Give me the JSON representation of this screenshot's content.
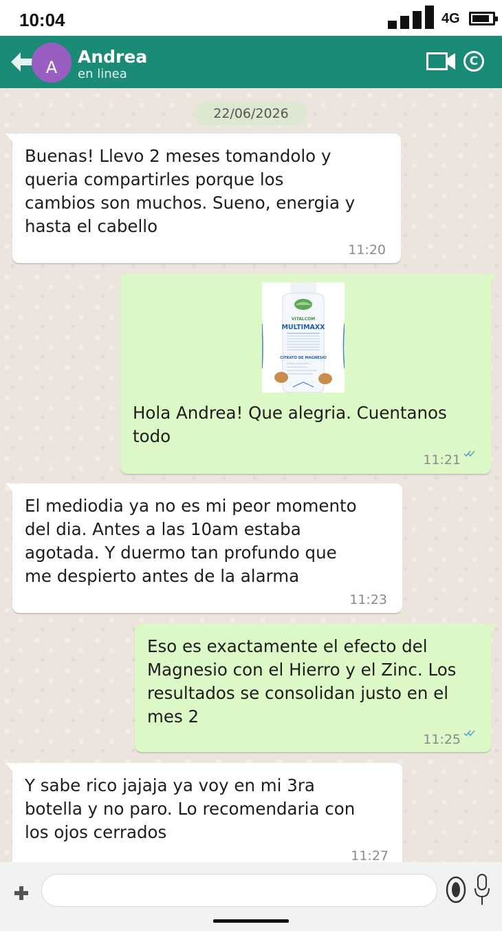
{
  "status_bar": {
    "time": "10:04",
    "network": "4G",
    "icons": [
      "signal-icon",
      "battery-icon"
    ]
  },
  "header": {
    "back_icon": "back-arrow-icon",
    "avatar_letter": "A",
    "name": "Andrea",
    "status": "en linea",
    "video_icon": "video-call-icon",
    "call_icon": "call-icon",
    "call_glyph": "C",
    "colors": {
      "header_bg": "#1a8b77",
      "avatar_bg": "#9a5dc1"
    }
  },
  "chat": {
    "date": "22/06/2026",
    "colors": {
      "incoming_bubble": "#ffffff",
      "outgoing_bubble": "#dcf8c6",
      "background": "#ece5dd",
      "read_ticks": "#4fa3d9"
    },
    "messages": [
      {
        "direction": "incoming",
        "lines": [
          "Buenas! Llevo 2 meses tomandolo y",
          "queria compartirles porque los",
          "cambios son muchos. Sueno, energia y",
          "hasta el cabello"
        ],
        "time": "11:20"
      },
      {
        "direction": "outgoing",
        "image": {
          "brand": "VITALCOM",
          "product": "MULTIMAXX",
          "subtitle": "CITRATO DE MAGNESIO"
        },
        "lines": [
          "Hola Andrea! Que alegria. Cuentanos",
          "todo"
        ],
        "time": "11:21",
        "read": true
      },
      {
        "direction": "incoming",
        "lines": [
          "El mediodia ya no es mi peor momento",
          "del dia. Antes a las 10am estaba",
          "agotada. Y duermo tan profundo que",
          "me despierto antes de la alarma"
        ],
        "time": "11:23"
      },
      {
        "direction": "outgoing",
        "lines": [
          "Eso es exactamente el efecto del",
          "Magnesio con el Hierro y el Zinc. Los",
          "resultados se consolidan justo en el",
          "mes 2"
        ],
        "time": "11:25",
        "read": true
      },
      {
        "direction": "incoming",
        "lines": [
          "Y sabe rico jajaja ya voy en mi 3ra",
          "botella y no paro. Lo recomendaria con",
          "los ojos cerrados"
        ],
        "time": "11:27"
      }
    ]
  },
  "input_bar": {
    "plus_icon": "plus-icon",
    "placeholder": "",
    "camera_icon": "camera-icon",
    "mic_icon": "microphone-icon"
  }
}
